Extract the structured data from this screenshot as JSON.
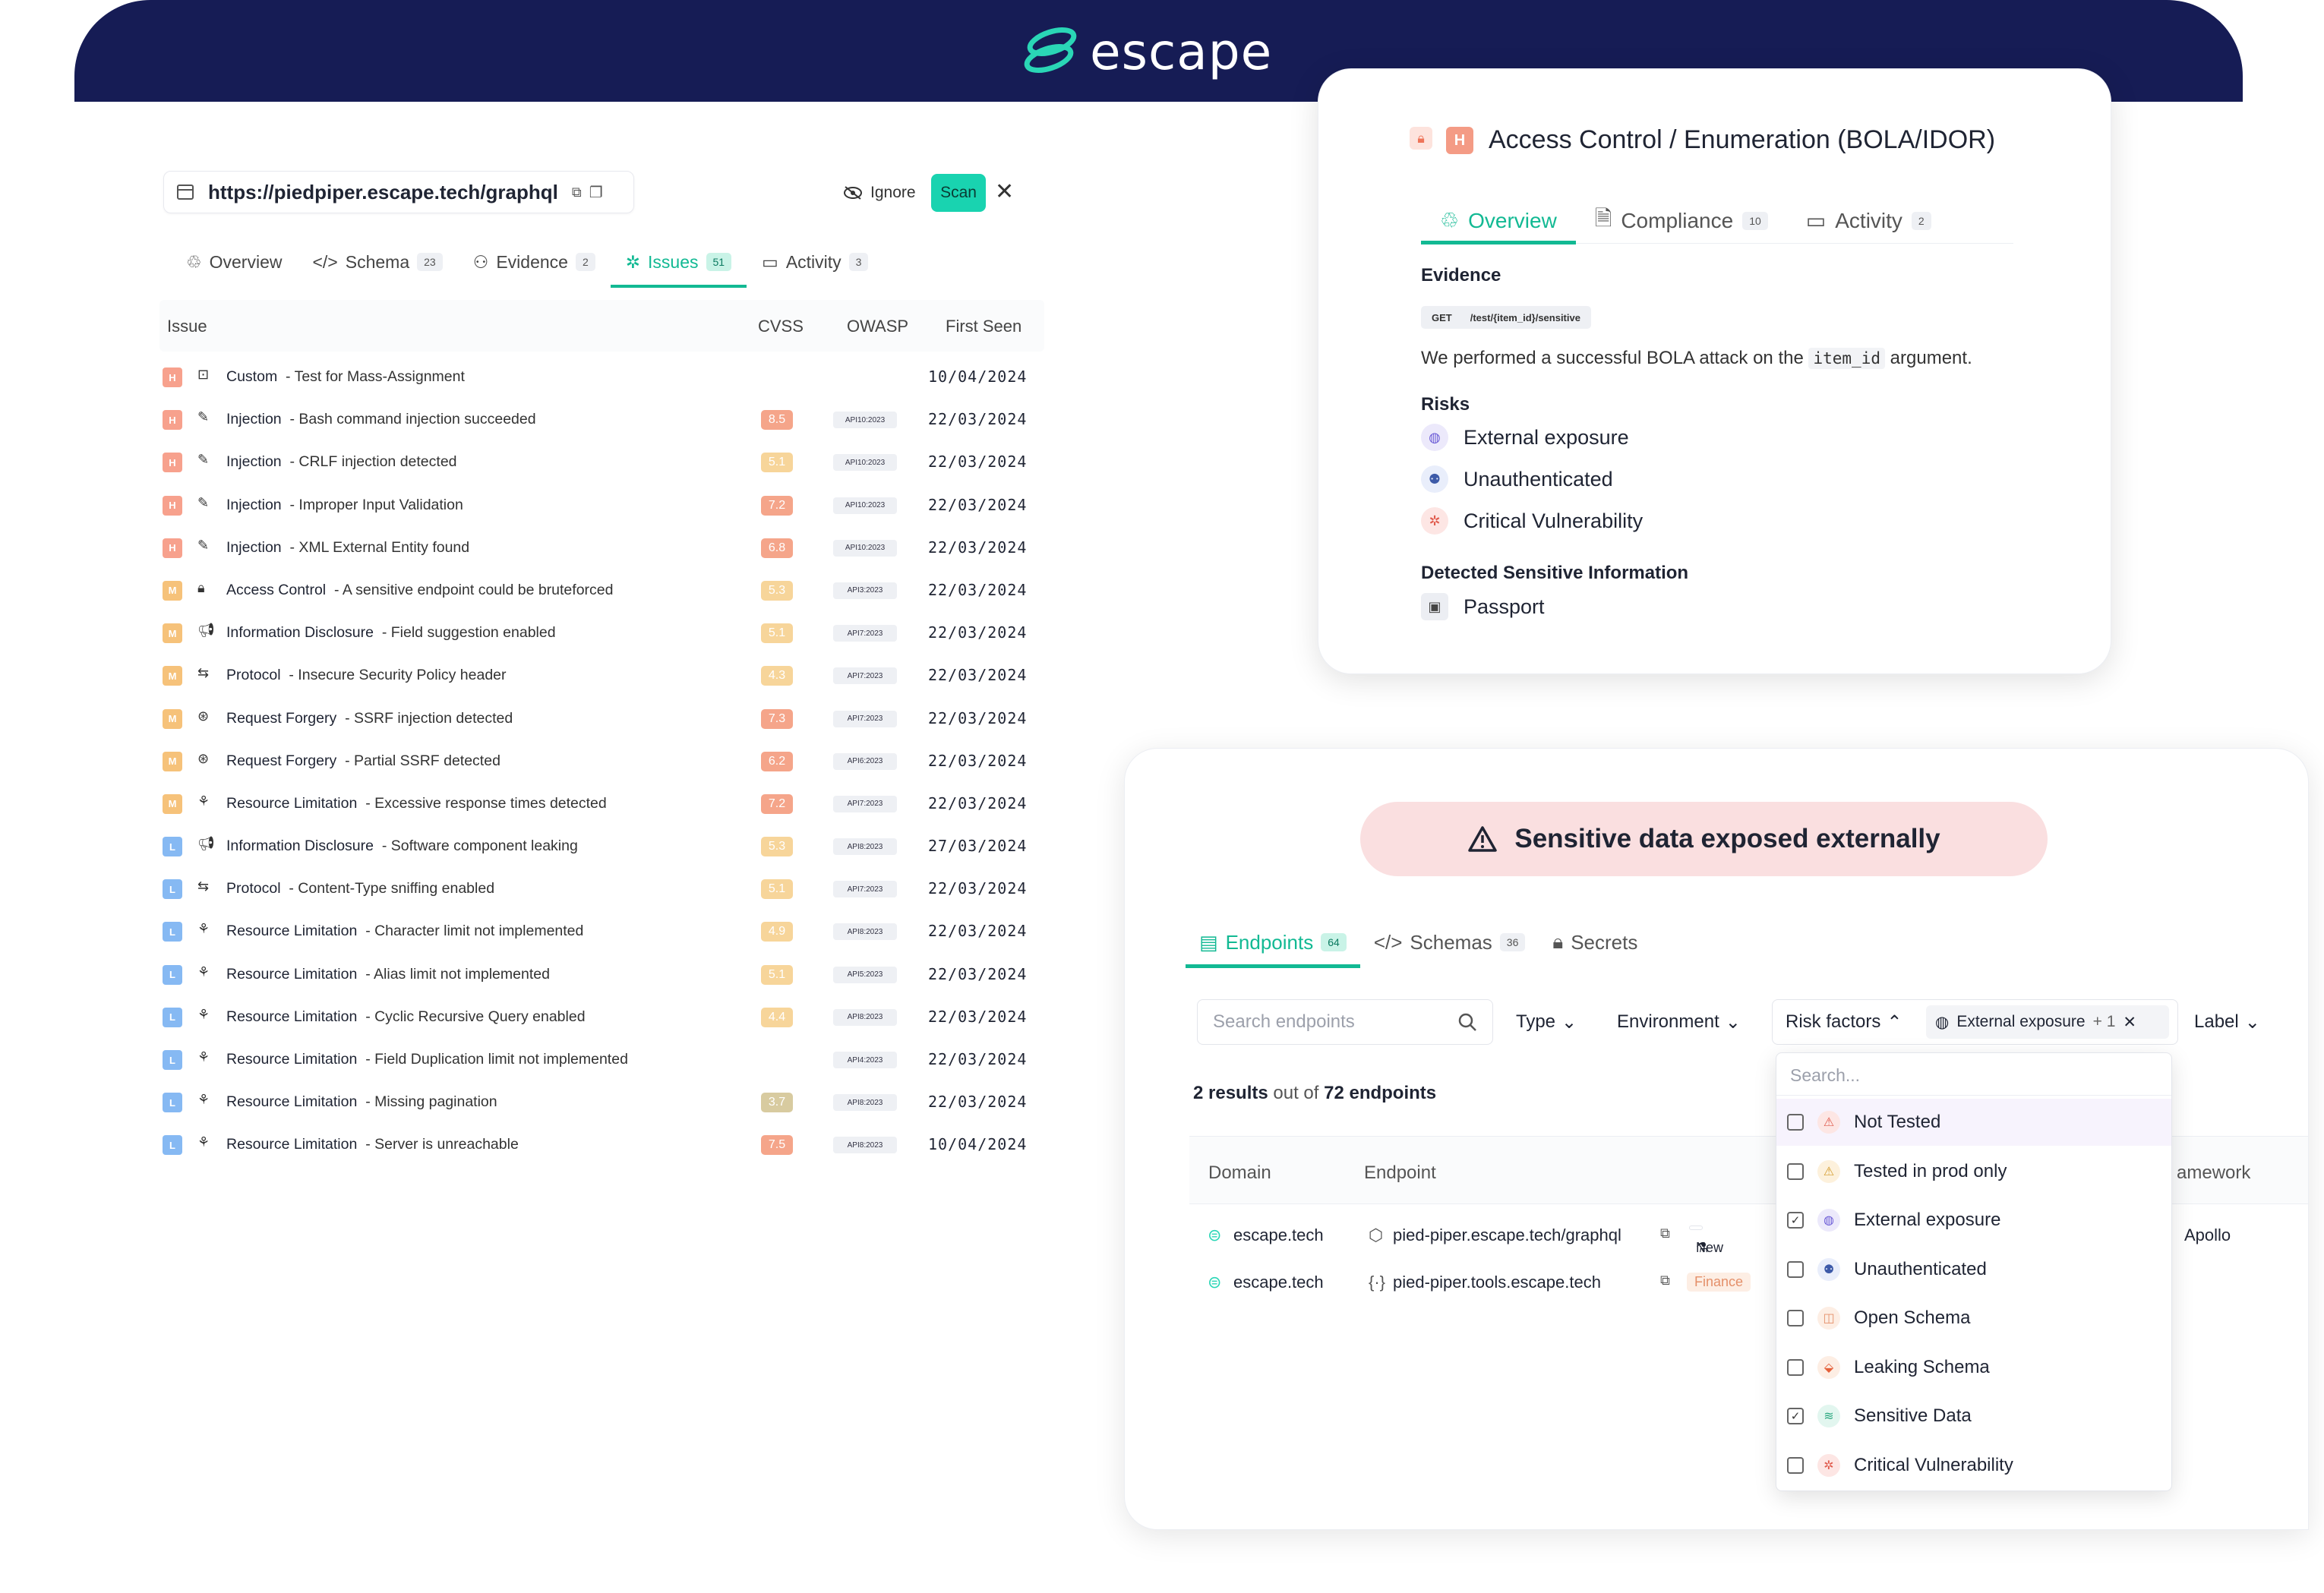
{
  "brand": {
    "name": "escape"
  },
  "left_panel": {
    "url": "https://piedpiper.escape.tech/graphql",
    "ignore_label": "Ignore",
    "scan_label": "Scan",
    "tabs": [
      {
        "label": "Overview",
        "count": ""
      },
      {
        "label": "Schema",
        "count": "23"
      },
      {
        "label": "Evidence",
        "count": "2"
      },
      {
        "label": "Issues",
        "count": "51"
      },
      {
        "label": "Activity",
        "count": "3"
      }
    ],
    "columns": {
      "issue": "Issue",
      "cvss": "CVSS",
      "owasp": "OWASP",
      "first_seen": "First Seen"
    },
    "rows": [
      {
        "sev": "H",
        "icon": "custom-icon",
        "cat": "Custom",
        "desc": "- Test for Mass-Assignment",
        "cvss": "",
        "cvss_color": "",
        "owasp": "",
        "date": "10/04/2024"
      },
      {
        "sev": "H",
        "icon": "injection-icon",
        "cat": "Injection",
        "desc": "- Bash command injection succeeded",
        "cvss": "8.5",
        "cvss_color": "#f5a58a",
        "owasp": "API10:2023",
        "date": "22/03/2024"
      },
      {
        "sev": "H",
        "icon": "injection-icon",
        "cat": "Injection",
        "desc": "- CRLF injection detected",
        "cvss": "5.1",
        "cvss_color": "#f7d59a",
        "owasp": "API10:2023",
        "date": "22/03/2024"
      },
      {
        "sev": "H",
        "icon": "injection-icon",
        "cat": "Injection",
        "desc": "- Improper Input Validation",
        "cvss": "7.2",
        "cvss_color": "#f5a58a",
        "owasp": "API10:2023",
        "date": "22/03/2024"
      },
      {
        "sev": "H",
        "icon": "injection-icon",
        "cat": "Injection",
        "desc": "- XML External Entity found",
        "cvss": "6.8",
        "cvss_color": "#f5a58a",
        "owasp": "API10:2023",
        "date": "22/03/2024"
      },
      {
        "sev": "M",
        "icon": "lock-icon",
        "cat": "Access Control",
        "desc": "- A sensitive endpoint could be bruteforced",
        "cvss": "5.3",
        "cvss_color": "#f7d59a",
        "owasp": "API3:2023",
        "date": "22/03/2024"
      },
      {
        "sev": "M",
        "icon": "megaphone-icon",
        "cat": "Information Disclosure",
        "desc": "- Field suggestion enabled",
        "cvss": "5.1",
        "cvss_color": "#f7d59a",
        "owasp": "API7:2023",
        "date": "22/03/2024"
      },
      {
        "sev": "M",
        "icon": "protocol-icon",
        "cat": "Protocol",
        "desc": "- Insecure Security Policy header",
        "cvss": "4.3",
        "cvss_color": "#f7d59a",
        "owasp": "API7:2023",
        "date": "22/03/2024"
      },
      {
        "sev": "M",
        "icon": "forgery-icon",
        "cat": "Request Forgery",
        "desc": "- SSRF injection detected",
        "cvss": "7.3",
        "cvss_color": "#f5a58a",
        "owasp": "API7:2023",
        "date": "22/03/2024"
      },
      {
        "sev": "M",
        "icon": "forgery-icon",
        "cat": "Request Forgery",
        "desc": "- Partial SSRF detected",
        "cvss": "6.2",
        "cvss_color": "#f5a58a",
        "owasp": "API6:2023",
        "date": "22/03/2024"
      },
      {
        "sev": "M",
        "icon": "resource-icon",
        "cat": "Resource Limitation",
        "desc": "- Excessive response times detected",
        "cvss": "7.2",
        "cvss_color": "#f5a58a",
        "owasp": "API7:2023",
        "date": "22/03/2024"
      },
      {
        "sev": "L",
        "icon": "megaphone-icon",
        "cat": "Information Disclosure",
        "desc": "- Software component leaking",
        "cvss": "5.3",
        "cvss_color": "#f7d59a",
        "owasp": "API8:2023",
        "date": "27/03/2024"
      },
      {
        "sev": "L",
        "icon": "protocol-icon",
        "cat": "Protocol",
        "desc": "- Content-Type sniffing enabled",
        "cvss": "5.1",
        "cvss_color": "#f7d59a",
        "owasp": "API7:2023",
        "date": "22/03/2024"
      },
      {
        "sev": "L",
        "icon": "resource-icon",
        "cat": "Resource Limitation",
        "desc": "- Character limit not implemented",
        "cvss": "4.9",
        "cvss_color": "#f7d59a",
        "owasp": "API8:2023",
        "date": "22/03/2024"
      },
      {
        "sev": "L",
        "icon": "resource-icon",
        "cat": "Resource Limitation",
        "desc": "- Alias limit not implemented",
        "cvss": "5.1",
        "cvss_color": "#f7d59a",
        "owasp": "API5:2023",
        "date": "22/03/2024"
      },
      {
        "sev": "L",
        "icon": "resource-icon",
        "cat": "Resource Limitation",
        "desc": "- Cyclic Recursive Query enabled",
        "cvss": "4.4",
        "cvss_color": "#f7d59a",
        "owasp": "API8:2023",
        "date": "22/03/2024"
      },
      {
        "sev": "L",
        "icon": "resource-icon",
        "cat": "Resource Limitation",
        "desc": "- Field Duplication limit not implemented",
        "cvss": "",
        "cvss_color": "",
        "owasp": "API4:2023",
        "date": "22/03/2024"
      },
      {
        "sev": "L",
        "icon": "resource-icon",
        "cat": "Resource Limitation",
        "desc": "- Missing pagination",
        "cvss": "3.7",
        "cvss_color": "#d8cba0",
        "owasp": "API8:2023",
        "date": "22/03/2024"
      },
      {
        "sev": "L",
        "icon": "resource-icon",
        "cat": "Resource Limitation",
        "desc": "- Server is unreachable",
        "cvss": "7.5",
        "cvss_color": "#f5a58a",
        "owasp": "API8:2023",
        "date": "10/04/2024"
      }
    ]
  },
  "access_card": {
    "severity": "H",
    "title": "Access Control",
    "subtitle": "/ Enumeration (BOLA/IDOR)",
    "tabs": [
      {
        "label": "Overview",
        "count": ""
      },
      {
        "label": "Compliance",
        "count": "10"
      },
      {
        "label": "Activity",
        "count": "2"
      }
    ],
    "evidence_heading": "Evidence",
    "evidence_method": "GET",
    "evidence_path": "/test/{item_id}/sensitive",
    "evidence_text_before": "We performed a successful BOLA attack on the",
    "evidence_code": "item_id",
    "evidence_text_after": "argument.",
    "risks_heading": "Risks",
    "risks": [
      "External exposure",
      "Unauthenticated",
      "Critical Vulnerability"
    ],
    "sensitive_heading": "Detected Sensitive Information",
    "sensitive_items": [
      "Passport"
    ]
  },
  "endpoints_card": {
    "alert": "Sensitive data exposed externally",
    "tabs": [
      {
        "label": "Endpoints",
        "count": "64"
      },
      {
        "label": "Schemas",
        "count": "36"
      },
      {
        "label": "Secrets",
        "count": ""
      }
    ],
    "search_placeholder": "Search endpoints",
    "filters": {
      "type": "Type",
      "environment": "Environment",
      "risk_factors": "Risk factors",
      "label": "Label"
    },
    "active_chip": "External exposure",
    "active_chip_more": "+ 1",
    "results_prefix": "2 results",
    "results_middle": "out of",
    "results_total": "72 endpoints",
    "columns": {
      "domain": "Domain",
      "endpoint": "Endpoint",
      "framework": "amework"
    },
    "rows": [
      {
        "domain": "escape.tech",
        "endpoint": "pied-piper.escape.tech/graphql",
        "tag": "New",
        "framework": "Apollo"
      },
      {
        "domain": "escape.tech",
        "endpoint": "pied-piper.tools.escape.tech",
        "tag": "Finance",
        "framework": ""
      }
    ],
    "dropdown": {
      "search_placeholder": "Search...",
      "items": [
        {
          "label": "Not Tested",
          "checked": false
        },
        {
          "label": "Tested in prod only",
          "checked": false
        },
        {
          "label": "External exposure",
          "checked": true
        },
        {
          "label": "Unauthenticated",
          "checked": false
        },
        {
          "label": "Open Schema",
          "checked": false
        },
        {
          "label": "Leaking Schema",
          "checked": false
        },
        {
          "label": "Sensitive Data",
          "checked": true
        },
        {
          "label": "Critical Vulnerability",
          "checked": false
        }
      ]
    }
  }
}
